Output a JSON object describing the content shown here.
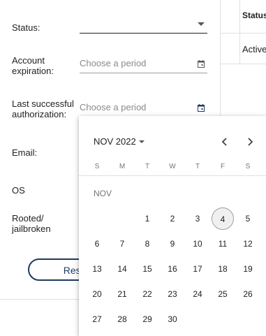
{
  "filters": {
    "status_label": "Status:",
    "account_expiration_label": "Account expiration:",
    "last_auth_label": "Last successful authorization:",
    "email_label": "Email:",
    "os_label": "OS",
    "rooted_label": "Rooted/ jailbroken",
    "period_placeholder": "Choose a period",
    "reset_label": "Reset"
  },
  "table": {
    "header_status": "Status",
    "row1_status": "Active"
  },
  "calendar": {
    "period_label": "NOV 2022",
    "month_label": "NOV",
    "weekdays": [
      "S",
      "M",
      "T",
      "W",
      "T",
      "F",
      "S"
    ],
    "today": "4",
    "weeks": [
      [
        "",
        "",
        "1",
        "2",
        "3",
        "4",
        "5"
      ],
      [
        "6",
        "7",
        "8",
        "9",
        "10",
        "11",
        "12"
      ],
      [
        "13",
        "14",
        "15",
        "16",
        "17",
        "18",
        "19"
      ],
      [
        "20",
        "21",
        "22",
        "23",
        "24",
        "25",
        "26"
      ],
      [
        "27",
        "28",
        "29",
        "30",
        "",
        "",
        ""
      ]
    ]
  },
  "colors": {
    "accent": "#1e3a5f",
    "divider": "#e0e0e0",
    "placeholder": "#8a8a8a"
  },
  "icons": [
    "dropdown-arrow-icon",
    "calendar-icon",
    "chevron-left-icon",
    "chevron-right-icon"
  ]
}
